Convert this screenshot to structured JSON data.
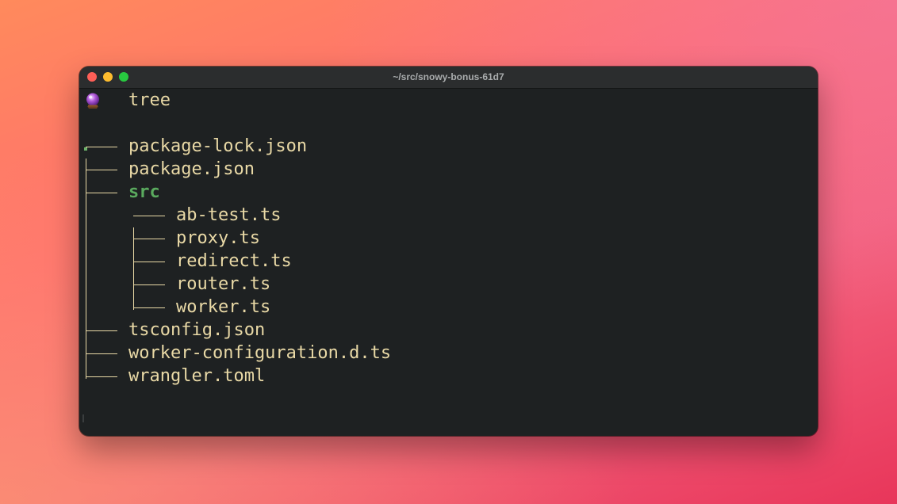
{
  "window": {
    "title": "~/src/snowy-bonus-61d7"
  },
  "prompt": {
    "icon": "crystal-ball-icon",
    "command": "tree"
  },
  "tree": {
    "root": ".",
    "items": [
      {
        "name": "package-lock.json",
        "depth": 0,
        "type": "file"
      },
      {
        "name": "package.json",
        "depth": 0,
        "type": "file"
      },
      {
        "name": "src",
        "depth": 0,
        "type": "dir"
      },
      {
        "name": "ab-test.ts",
        "depth": 1,
        "type": "file"
      },
      {
        "name": "proxy.ts",
        "depth": 1,
        "type": "file"
      },
      {
        "name": "redirect.ts",
        "depth": 1,
        "type": "file"
      },
      {
        "name": "router.ts",
        "depth": 1,
        "type": "file"
      },
      {
        "name": "worker.ts",
        "depth": 1,
        "type": "file"
      },
      {
        "name": "tsconfig.json",
        "depth": 0,
        "type": "file"
      },
      {
        "name": "worker-configuration.d.ts",
        "depth": 0,
        "type": "file"
      },
      {
        "name": "wrangler.toml",
        "depth": 0,
        "type": "file"
      }
    ]
  },
  "colors": {
    "file_text": "#e9d9a6",
    "dir_text": "#5aaa5e",
    "terminal_bg": "#1e2122",
    "titlebar_bg": "#2b2d2e"
  }
}
